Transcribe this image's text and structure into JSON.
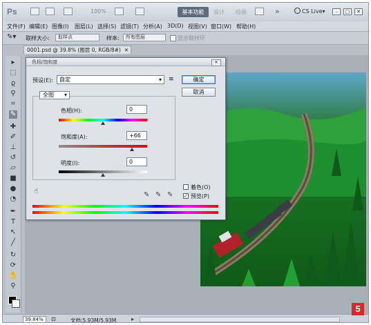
{
  "app": {
    "logo": "Ps",
    "zoom_field": "100%",
    "workspace_active": "基本功能",
    "workspace_alt_1": "设计",
    "workspace_alt_2": "绘画",
    "more_label": "»",
    "cs_live": "CS Live"
  },
  "menu": [
    "文件(F)",
    "编辑(E)",
    "图像(I)",
    "图层(L)",
    "选择(S)",
    "滤镜(T)",
    "分析(A)",
    "3D(D)",
    "视图(V)",
    "窗口(W)",
    "帮助(H)"
  ],
  "options_bar": {
    "sample_size_label": "取样大小:",
    "sample_size_value": "取样点",
    "sample_label": "样本:",
    "sample_value": "所有图层",
    "show_ring_label": "显示取样环"
  },
  "document": {
    "tab_title": "0001.psd @ 39.8% (图层 0, RGB/8#)"
  },
  "dialog": {
    "title": "色相/饱和度",
    "preset_label": "预设(E):",
    "preset_value": "自定",
    "ok_label": "确定",
    "cancel_label": "取消",
    "edit_value": "全图",
    "hue_label": "色相(H):",
    "hue_value": "0",
    "saturation_label": "饱和度(A):",
    "saturation_value": "+66",
    "lightness_label": "明度(I):",
    "lightness_value": "0",
    "colorize_label": "着色(O)",
    "preview_label": "预览(P)",
    "colorize_checked": false,
    "preview_checked": true
  },
  "status": {
    "zoom": "39.84%",
    "doc_info": "文档:5.93M/5.93M"
  },
  "badge": "5"
}
